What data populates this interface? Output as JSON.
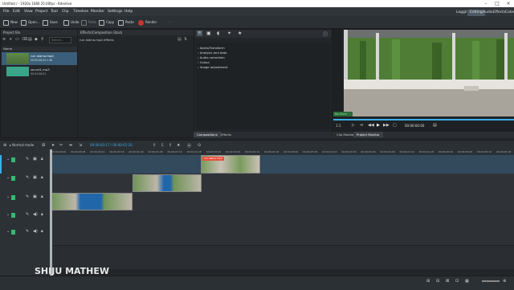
{
  "window": {
    "title": "Untitled / - 1920x 1080 25.00fps - Kdenlive"
  },
  "menu": [
    "File",
    "Edit",
    "View",
    "Project",
    "Tool",
    "Clip",
    "Timeline",
    "Monitor",
    "Settings",
    "Help"
  ],
  "workspaces": [
    "Logging",
    "Editing",
    "Audio",
    "Effects",
    "Color"
  ],
  "active_workspace": "Editing",
  "toolbar": {
    "new": "New",
    "open": "Open...",
    "save": "Save",
    "undo": "Undo",
    "redo": "Redo",
    "copy": "Copy",
    "paste": "Paste",
    "render": "Render"
  },
  "project_bin": {
    "title": "Project Bin",
    "search_placeholder": "Search...",
    "column_name": "Name",
    "clips": [
      {
        "name": "run alaina.mp4",
        "meta": "00:00:06:02 ▾ 4K"
      },
      {
        "name": "sound1.mp3",
        "meta": "00:04:08:01"
      }
    ]
  },
  "effect_stack": {
    "title": "Effects/Composition Stack",
    "subtitle": "run alaina.mp4 effects"
  },
  "effects_list": {
    "categories": [
      "Alpha/Transform",
      "Analysis and data",
      "Audio correction",
      "Colour",
      "Image adjustment"
    ],
    "tabs": [
      "Compositions",
      "Effects"
    ]
  },
  "monitor": {
    "zoom": "1:1",
    "timecode": "00:00:00:00",
    "tabs": [
      "Clip Monitor",
      "Project Monitor"
    ],
    "active_tab": "Project Monitor",
    "overlay_label": "No Zone"
  },
  "timeline_toolbar": {
    "mode": "Normal mode",
    "timecode": "00:00:03:17 / 00:00:01:20"
  },
  "ruler_ticks": [
    "00:00:00:00",
    "00:00:00:06",
    "00:00:00:12",
    "00:00:00:18",
    "00:00:01:00",
    "00:00:01:06",
    "00:00:01:12",
    "00:00:01:18",
    "00:00:02:00",
    "00:00:02:06",
    "00:00:02:12",
    "00:00:02:18",
    "00:00:03:00",
    "00:00:03:06",
    "00:00:03:12",
    "00:00:03:18",
    "00:00:04:00",
    "00:00:04:06",
    "00:00:04:12",
    "00:00:04:18",
    "00:00:05:00",
    "00:00:05:06",
    "00:00:05:12",
    "00:00:05:18"
  ],
  "tracks": [
    {
      "kind": "video",
      "tag": "V3"
    },
    {
      "kind": "video",
      "tag": "V2"
    },
    {
      "kind": "video",
      "tag": "V1"
    },
    {
      "kind": "audio",
      "tag": "A1"
    },
    {
      "kind": "audio",
      "tag": "A2"
    }
  ],
  "top_clip_label": "run alaina.mp4",
  "watermark": "SHIJU MATHEW",
  "colors": {
    "accent": "#3daee9",
    "audio_tag": "#38b86f",
    "clip_label": "#e74c3c"
  }
}
